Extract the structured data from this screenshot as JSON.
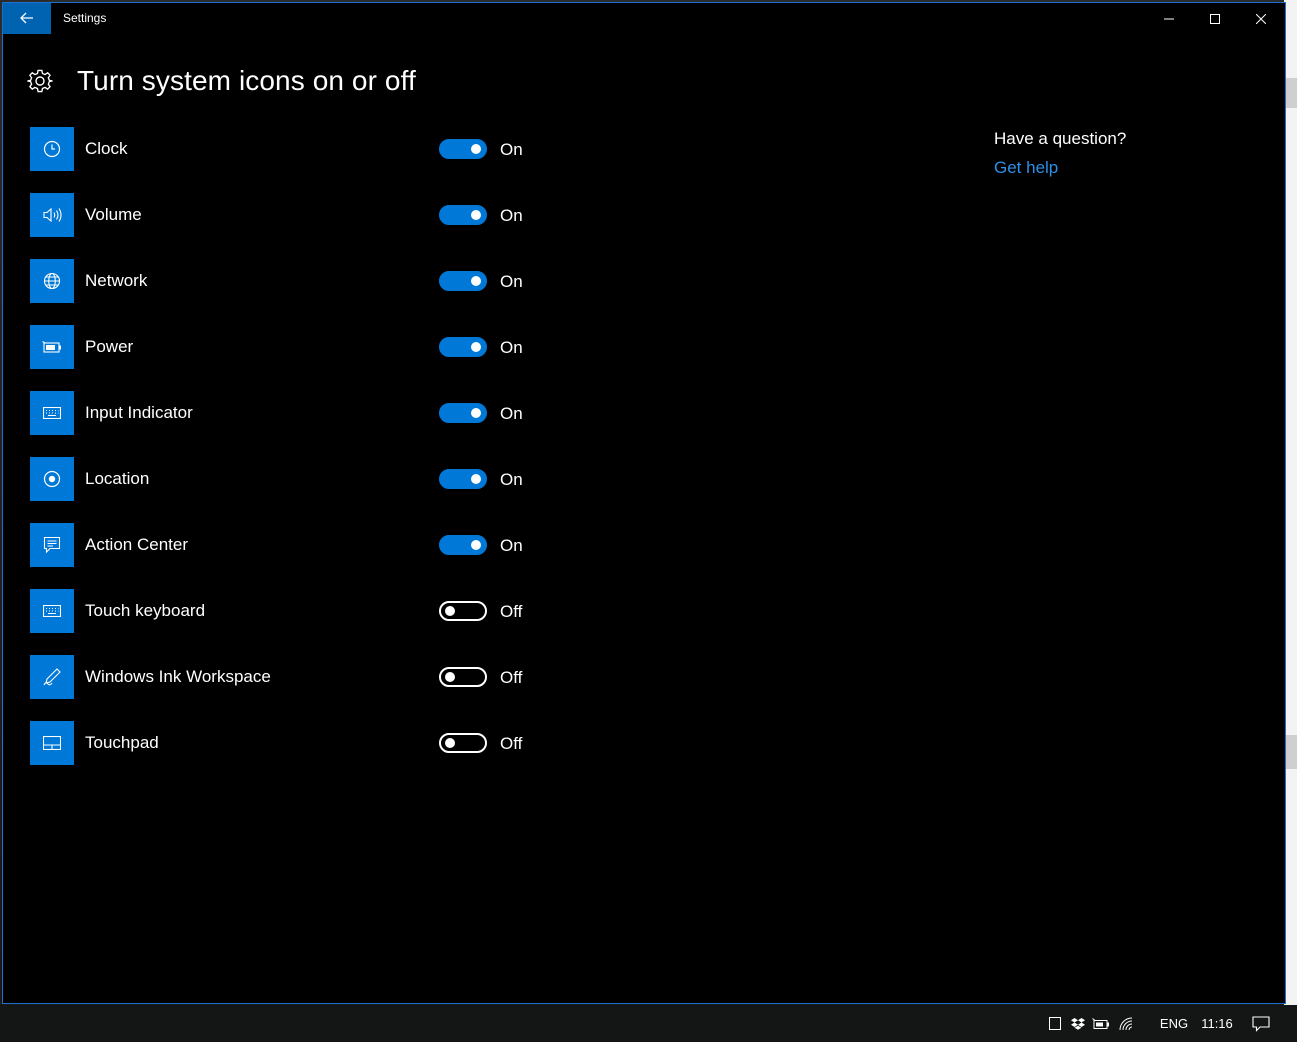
{
  "window": {
    "title": "Settings",
    "accent_color": "#0078d7",
    "back_icon": "arrow-left-icon",
    "caption_buttons": [
      "minimize-icon",
      "maximize-icon",
      "close-icon"
    ]
  },
  "page": {
    "icon": "gear-icon",
    "title": "Turn system icons on or off"
  },
  "settings": [
    {
      "label": "Clock",
      "icon": "clock-icon",
      "state": "On",
      "enabled": true
    },
    {
      "label": "Volume",
      "icon": "volume-icon",
      "state": "On",
      "enabled": true
    },
    {
      "label": "Network",
      "icon": "globe-icon",
      "state": "On",
      "enabled": true
    },
    {
      "label": "Power",
      "icon": "battery-icon",
      "state": "On",
      "enabled": true
    },
    {
      "label": "Input Indicator",
      "icon": "keyboard-icon",
      "state": "On",
      "enabled": true
    },
    {
      "label": "Location",
      "icon": "location-icon",
      "state": "On",
      "enabled": true
    },
    {
      "label": "Action Center",
      "icon": "action-center-icon",
      "state": "On",
      "enabled": true
    },
    {
      "label": "Touch keyboard",
      "icon": "keyboard-icon",
      "state": "Off",
      "enabled": false
    },
    {
      "label": "Windows Ink Workspace",
      "icon": "pen-icon",
      "state": "Off",
      "enabled": false
    },
    {
      "label": "Touchpad",
      "icon": "touchpad-icon",
      "state": "Off",
      "enabled": false
    }
  ],
  "help": {
    "question": "Have a question?",
    "link": "Get help",
    "link_color": "#2d8fe8"
  },
  "taskbar": {
    "icons": [
      "tablet-mode-icon",
      "dropbox-icon",
      "battery-icon",
      "wifi-icon"
    ],
    "language": "ENG",
    "time": "11:16",
    "notification_icon": "notification-icon"
  }
}
